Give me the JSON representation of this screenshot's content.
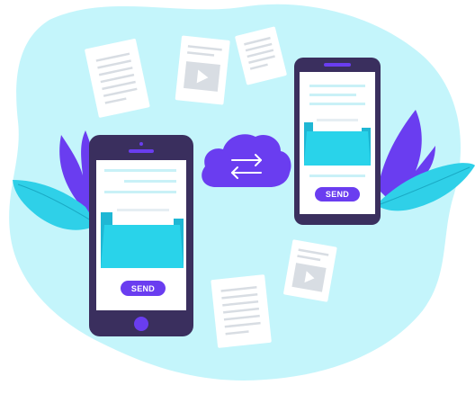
{
  "illustration": {
    "left_phone": {
      "send_label": "SEND"
    },
    "right_phone": {
      "send_label": "SEND"
    },
    "cloud": {
      "icon": "transfer-arrows-icon"
    }
  },
  "colors": {
    "blob": "#c4f5fb",
    "phone_frame": "#3a2f5e",
    "accent_purple": "#6a3df0",
    "folder_cyan": "#29d3ea",
    "folder_back": "#1fb7d4",
    "leaf_cyan": "#2fd0e8",
    "paper": "#ffffff",
    "paper_lines": "#d8dde3"
  }
}
